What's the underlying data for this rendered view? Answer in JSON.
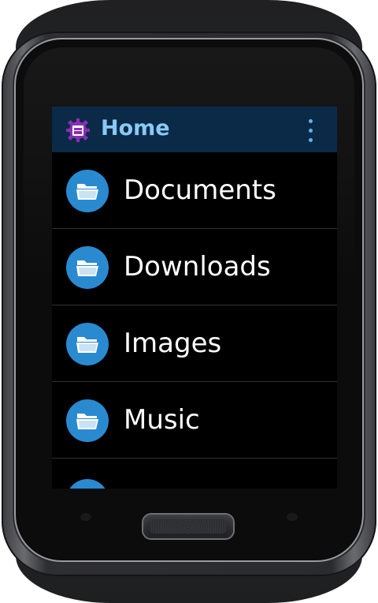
{
  "app_bar": {
    "title": "Home",
    "app_icon": "file-manager-icon",
    "menu_icon": "overflow-menu-icon"
  },
  "list": {
    "items": [
      {
        "label": "Documents",
        "icon": "folder-icon"
      },
      {
        "label": "Downloads",
        "icon": "folder-icon"
      },
      {
        "label": "Images",
        "icon": "folder-icon"
      },
      {
        "label": "Music",
        "icon": "folder-icon"
      }
    ]
  },
  "colors": {
    "app_bar_bg": "#0b2a47",
    "title": "#89c9f5",
    "folder_circle": "#2a8ad0",
    "screen_bg": "#000000",
    "app_icon": "#8a2fb5"
  }
}
